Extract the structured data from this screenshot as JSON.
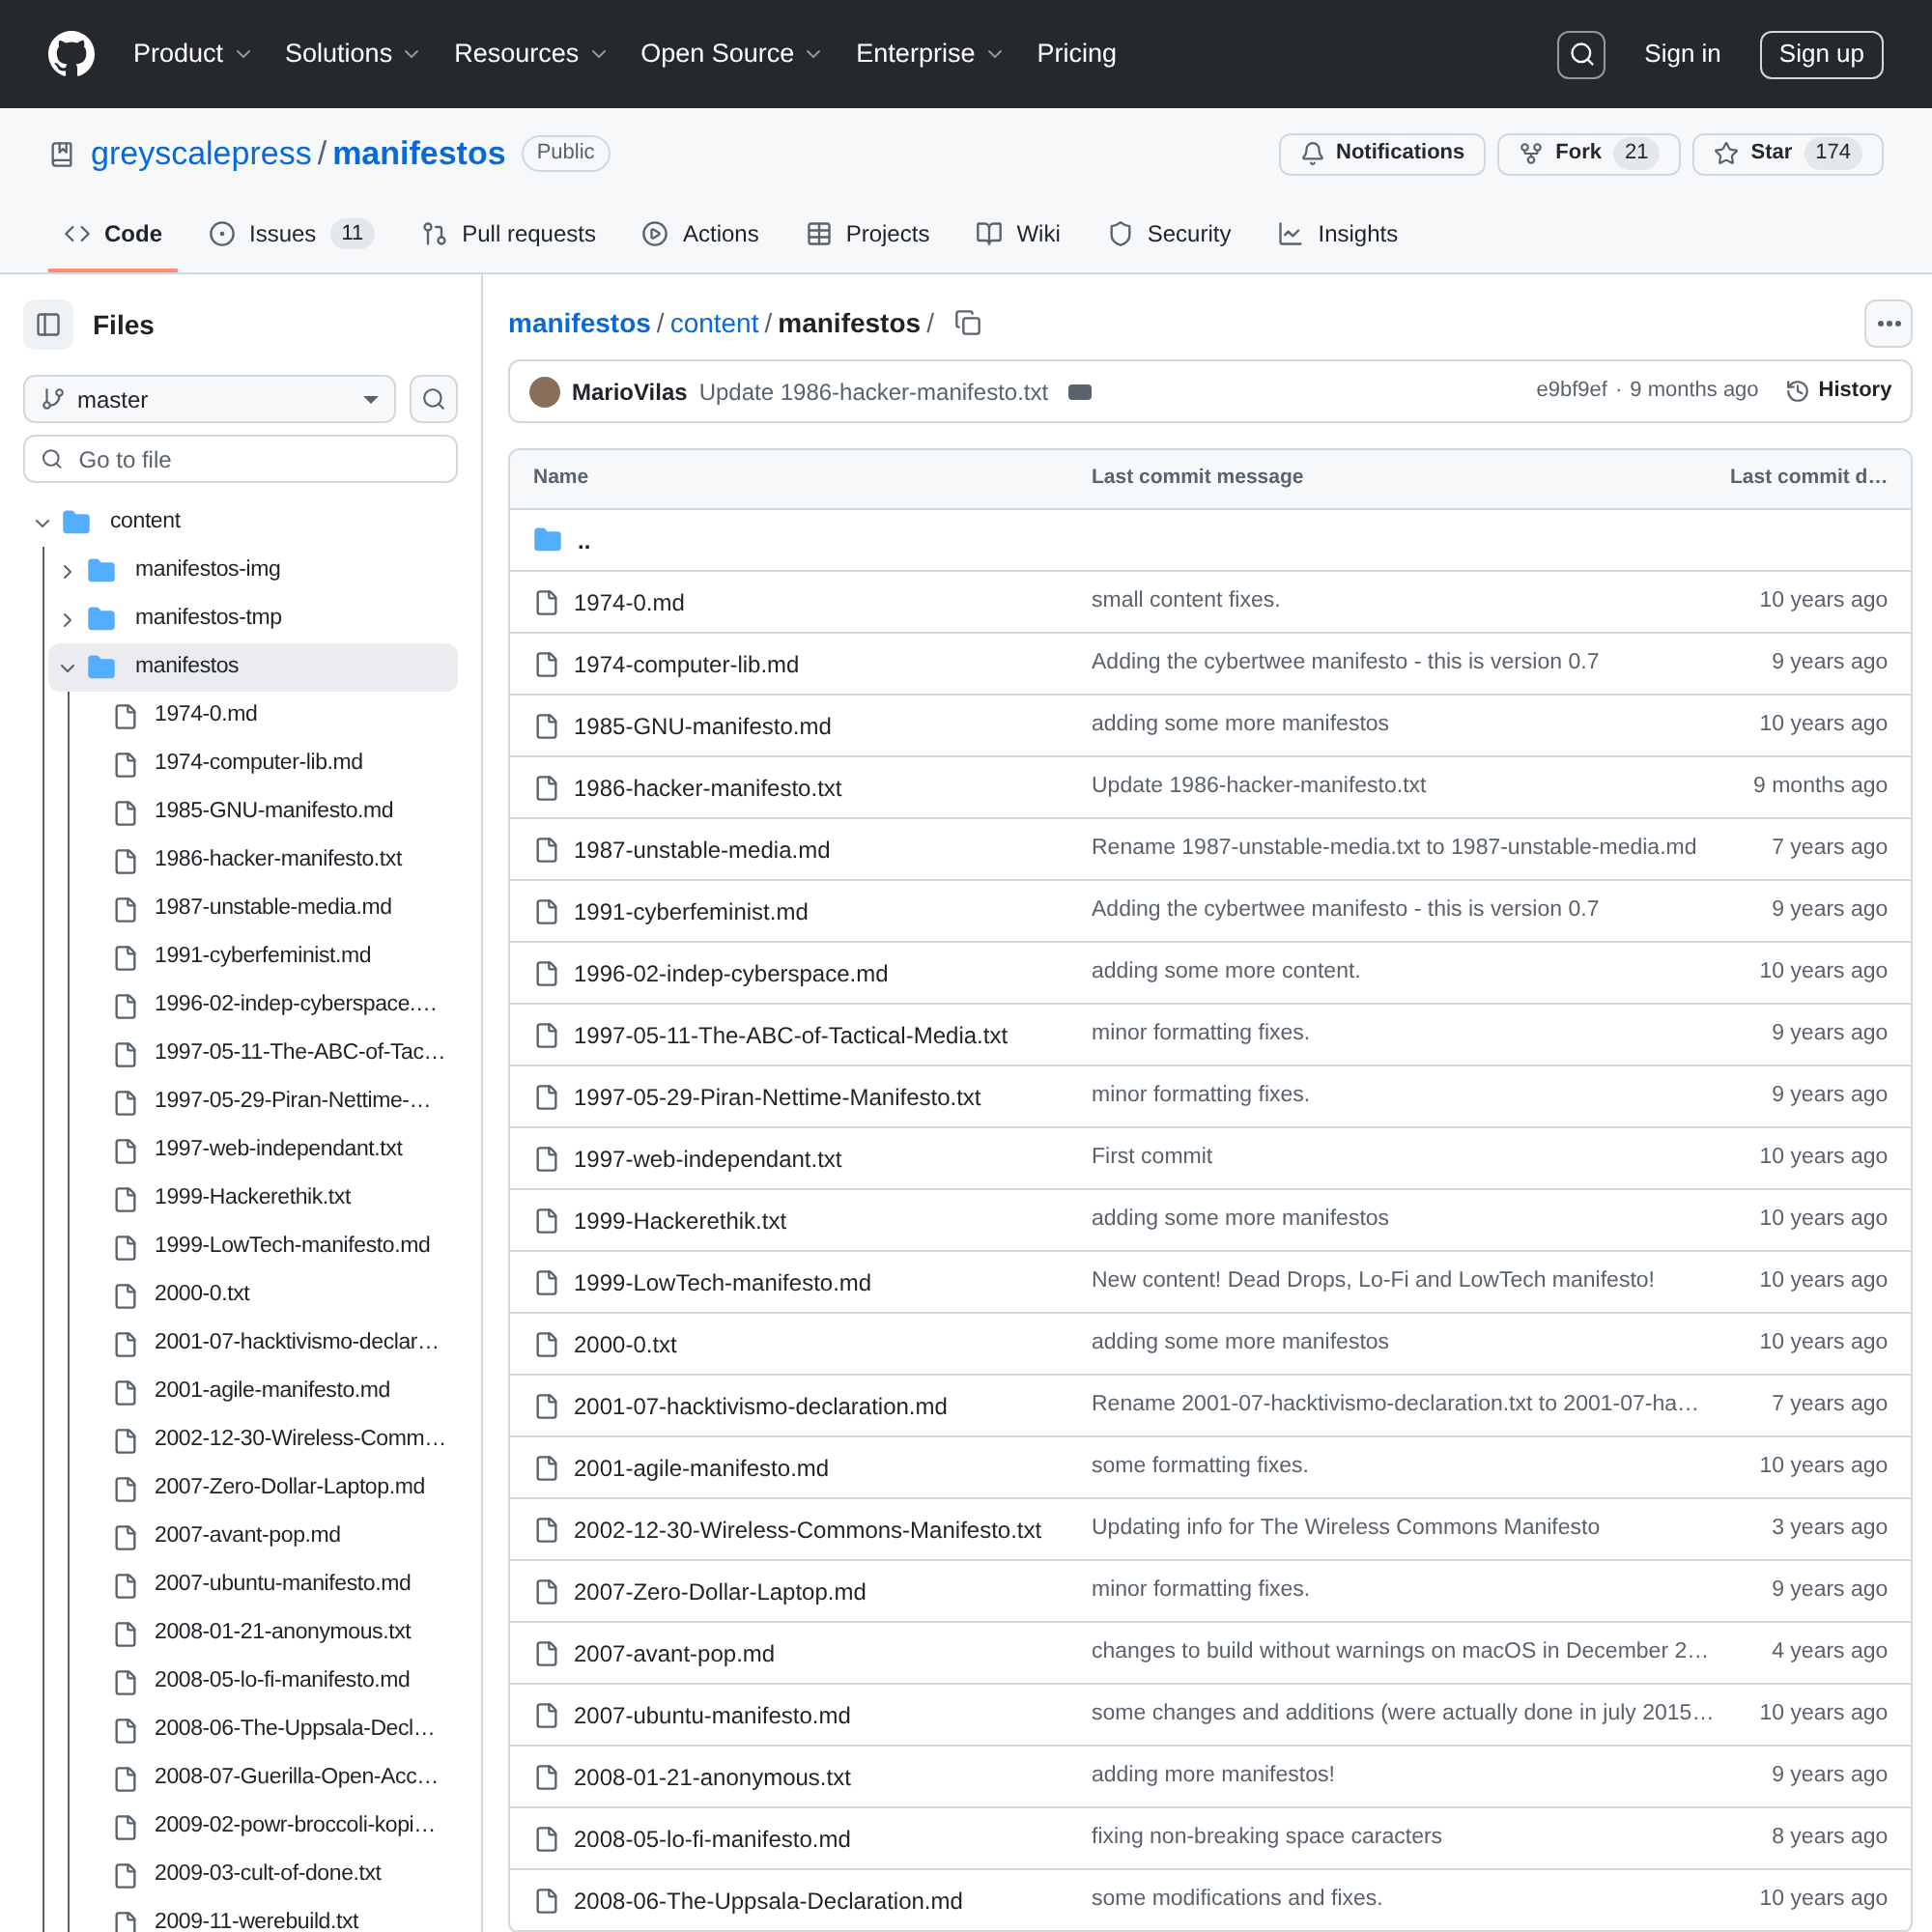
{
  "header": {
    "nav": [
      {
        "label": "Product",
        "dropdown": true
      },
      {
        "label": "Solutions",
        "dropdown": true
      },
      {
        "label": "Resources",
        "dropdown": true
      },
      {
        "label": "Open Source",
        "dropdown": true
      },
      {
        "label": "Enterprise",
        "dropdown": true
      },
      {
        "label": "Pricing",
        "dropdown": false
      }
    ],
    "sign_in": "Sign in",
    "sign_up": "Sign up"
  },
  "repo": {
    "owner": "greyscalepress",
    "separator": "/",
    "name": "manifestos",
    "visibility": "Public",
    "actions": [
      {
        "kind": "bell",
        "label": "Notifications"
      },
      {
        "kind": "fork",
        "label": "Fork",
        "count": "21"
      },
      {
        "kind": "star",
        "label": "Star",
        "count": "174"
      }
    ]
  },
  "tabs": [
    {
      "kind": "code",
      "label": "Code",
      "selected": true
    },
    {
      "kind": "issues",
      "label": "Issues",
      "count": "11",
      "selected": false
    },
    {
      "kind": "pulls",
      "label": "Pull requests",
      "selected": false
    },
    {
      "kind": "actions",
      "label": "Actions",
      "selected": false
    },
    {
      "kind": "projects",
      "label": "Projects",
      "selected": false
    },
    {
      "kind": "wiki",
      "label": "Wiki",
      "selected": false
    },
    {
      "kind": "security",
      "label": "Security",
      "selected": false
    },
    {
      "kind": "insights",
      "label": "Insights",
      "selected": false
    }
  ],
  "sidebar": {
    "title": "Files",
    "branch": "master",
    "search_placeholder": "Go to file",
    "tree": [
      {
        "name": "content",
        "kind": "folder",
        "expanded": true,
        "selected": false,
        "children": [
          {
            "name": "manifestos-img",
            "kind": "folder",
            "expanded": false,
            "selected": false
          },
          {
            "name": "manifestos-tmp",
            "kind": "folder",
            "expanded": false,
            "selected": false
          },
          {
            "name": "manifestos",
            "kind": "folder",
            "expanded": true,
            "selected": true,
            "children": [
              {
                "name": "1974-0.md",
                "kind": "file"
              },
              {
                "name": "1974-computer-lib.md",
                "kind": "file"
              },
              {
                "name": "1985-GNU-manifesto.md",
                "kind": "file"
              },
              {
                "name": "1986-hacker-manifesto.txt",
                "kind": "file"
              },
              {
                "name": "1987-unstable-media.md",
                "kind": "file"
              },
              {
                "name": "1991-cyberfeminist.md",
                "kind": "file"
              },
              {
                "name": "1996-02-indep-cyberspace.…",
                "kind": "file"
              },
              {
                "name": "1997-05-11-The-ABC-of-Tac…",
                "kind": "file"
              },
              {
                "name": "1997-05-29-Piran-Nettime-…",
                "kind": "file"
              },
              {
                "name": "1997-web-independant.txt",
                "kind": "file"
              },
              {
                "name": "1999-Hackerethik.txt",
                "kind": "file"
              },
              {
                "name": "1999-LowTech-manifesto.md",
                "kind": "file"
              },
              {
                "name": "2000-0.txt",
                "kind": "file"
              },
              {
                "name": "2001-07-hacktivismo-declar…",
                "kind": "file"
              },
              {
                "name": "2001-agile-manifesto.md",
                "kind": "file"
              },
              {
                "name": "2002-12-30-Wireless-Comm…",
                "kind": "file"
              },
              {
                "name": "2007-Zero-Dollar-Laptop.md",
                "kind": "file"
              },
              {
                "name": "2007-avant-pop.md",
                "kind": "file"
              },
              {
                "name": "2007-ubuntu-manifesto.md",
                "kind": "file"
              },
              {
                "name": "2008-01-21-anonymous.txt",
                "kind": "file"
              },
              {
                "name": "2008-05-lo-fi-manifesto.md",
                "kind": "file"
              },
              {
                "name": "2008-06-The-Uppsala-Decl…",
                "kind": "file"
              },
              {
                "name": "2008-07-Guerilla-Open-Acc…",
                "kind": "file"
              },
              {
                "name": "2009-02-powr-broccoli-kopi…",
                "kind": "file"
              },
              {
                "name": "2009-03-cult-of-done.txt",
                "kind": "file"
              },
              {
                "name": "2009-11-werebuild.txt",
                "kind": "file"
              }
            ]
          }
        ]
      }
    ]
  },
  "breadcrumb": {
    "parts": [
      "manifestos",
      "content",
      "manifestos"
    ],
    "separator": "/"
  },
  "commit": {
    "author": "MarioVilas",
    "message": "Update 1986-hacker-manifesto.txt",
    "sha": "e9bf9ef",
    "dot": "·",
    "time": "9 months ago",
    "history": "History"
  },
  "table": {
    "columns": [
      "Name",
      "Last commit message",
      "Last commit d…"
    ],
    "parent": "..",
    "rows": [
      {
        "name": "1974-0.md",
        "message": "small content fixes.",
        "date": "10 years ago"
      },
      {
        "name": "1974-computer-lib.md",
        "message": "Adding the cybertwee manifesto - this is version 0.7",
        "date": "9 years ago"
      },
      {
        "name": "1985-GNU-manifesto.md",
        "message": "adding some more manifestos",
        "date": "10 years ago"
      },
      {
        "name": "1986-hacker-manifesto.txt",
        "message": "Update 1986-hacker-manifesto.txt",
        "date": "9 months ago"
      },
      {
        "name": "1987-unstable-media.md",
        "message": "Rename 1987-unstable-media.txt to 1987-unstable-media.md",
        "date": "7 years ago"
      },
      {
        "name": "1991-cyberfeminist.md",
        "message": "Adding the cybertwee manifesto - this is version 0.7",
        "date": "9 years ago"
      },
      {
        "name": "1996-02-indep-cyberspace.md",
        "message": "adding some more content.",
        "date": "10 years ago"
      },
      {
        "name": "1997-05-11-The-ABC-of-Tactical-Media.txt",
        "message": "minor formatting fixes.",
        "date": "9 years ago"
      },
      {
        "name": "1997-05-29-Piran-Nettime-Manifesto.txt",
        "message": "minor formatting fixes.",
        "date": "9 years ago"
      },
      {
        "name": "1997-web-independant.txt",
        "message": "First commit",
        "date": "10 years ago"
      },
      {
        "name": "1999-Hackerethik.txt",
        "message": "adding some more manifestos",
        "date": "10 years ago"
      },
      {
        "name": "1999-LowTech-manifesto.md",
        "message": "New content! Dead Drops, Lo-Fi and LowTech manifesto!",
        "date": "10 years ago"
      },
      {
        "name": "2000-0.txt",
        "message": "adding some more manifestos",
        "date": "10 years ago"
      },
      {
        "name": "2001-07-hacktivismo-declaration.md",
        "message": "Rename 2001-07-hacktivismo-declaration.txt to 2001-07-ha…",
        "date": "7 years ago"
      },
      {
        "name": "2001-agile-manifesto.md",
        "message": "some formatting fixes.",
        "date": "10 years ago"
      },
      {
        "name": "2002-12-30-Wireless-Commons-Manifesto.txt",
        "message": "Updating info for The Wireless Commons Manifesto",
        "date": "3 years ago"
      },
      {
        "name": "2007-Zero-Dollar-Laptop.md",
        "message": "minor formatting fixes.",
        "date": "9 years ago"
      },
      {
        "name": "2007-avant-pop.md",
        "message": "changes to build without warnings on macOS in December 2…",
        "date": "4 years ago"
      },
      {
        "name": "2007-ubuntu-manifesto.md",
        "message": "some changes and additions (were actually done in july 2015…",
        "date": "10 years ago"
      },
      {
        "name": "2008-01-21-anonymous.txt",
        "message": "adding more manifestos!",
        "date": "9 years ago"
      },
      {
        "name": "2008-05-lo-fi-manifesto.md",
        "message": "fixing non-breaking space caracters",
        "date": "8 years ago"
      },
      {
        "name": "2008-06-The-Uppsala-Declaration.md",
        "message": "some modifications and fixes.",
        "date": "10 years ago"
      }
    ]
  }
}
